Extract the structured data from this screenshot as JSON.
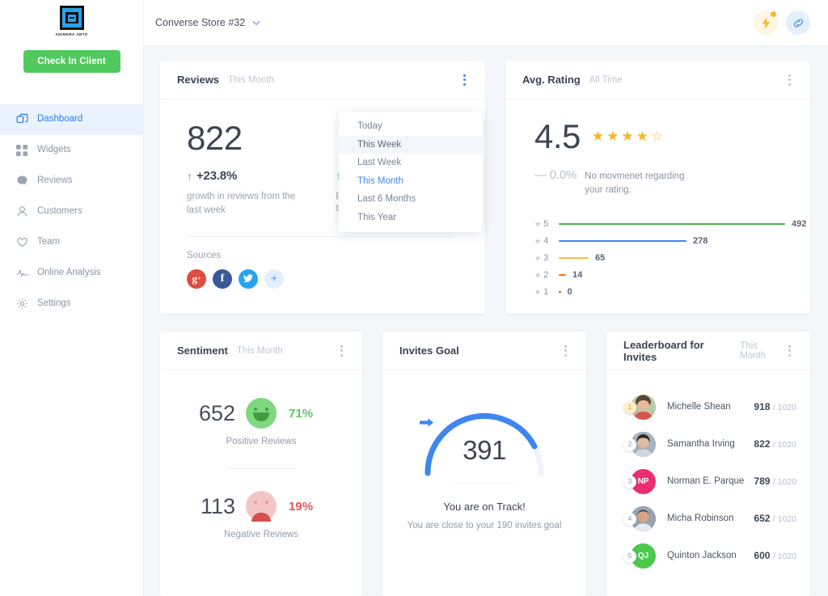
{
  "brand": {
    "name": "ADINKRA ARTS",
    "logo_icon": "adinkra-square-logo"
  },
  "sidebar": {
    "cta_label": "Check In Client",
    "items": [
      {
        "label": "Dashboard",
        "icon": "layers-icon",
        "active": true
      },
      {
        "label": "Widgets",
        "icon": "grid-icon",
        "active": false
      },
      {
        "label": "Reviews",
        "icon": "speech-bubble-icon",
        "active": false
      },
      {
        "label": "Customers",
        "icon": "user-icon",
        "active": false
      },
      {
        "label": "Team",
        "icon": "heart-icon",
        "active": false
      },
      {
        "label": "Online Analysis",
        "icon": "pulse-icon",
        "active": false
      },
      {
        "label": "Settings",
        "icon": "gear-icon",
        "active": false
      }
    ]
  },
  "topbar": {
    "store_name": "Converse Store #32",
    "chevron_icon": "chevron-down-icon",
    "actions": [
      {
        "icon": "lightning-bolt-icon",
        "has_badge": true
      },
      {
        "icon": "link-chain-icon",
        "has_badge": false
      }
    ]
  },
  "reviews_card": {
    "title": "Reviews",
    "period": "This Month",
    "count": "822",
    "delta": "+23.8%",
    "delta_icon": "arrow-up-icon",
    "delta_desc": "growth in reviews from the last week",
    "sources_label": "Sources",
    "sources": [
      {
        "name": "google-plus",
        "glyph": "g+",
        "color": "#dc4e41"
      },
      {
        "name": "facebook",
        "glyph": "f",
        "color": "#3b5998"
      },
      {
        "name": "twitter",
        "glyph": "ᴠ",
        "color": "#2aa3ef"
      },
      {
        "name": "add-source",
        "glyph": "+",
        "color": "#e6f0fd"
      }
    ],
    "dropdown": {
      "items": [
        {
          "label": "Today",
          "state": "normal"
        },
        {
          "label": "This Week",
          "state": "hover"
        },
        {
          "label": "Last Week",
          "state": "normal"
        },
        {
          "label": "This Month",
          "state": "selected"
        },
        {
          "label": "Last 6 Months",
          "state": "normal"
        },
        {
          "label": "This Year",
          "state": "normal"
        }
      ]
    }
  },
  "rating_card": {
    "title": "Avg. Rating",
    "period": "All Time",
    "score": "4.5",
    "stars_filled": 4,
    "stars_half": 1,
    "movement": "0.0%",
    "movement_icon": "dash-icon",
    "movement_desc": "No movmenet regarding your rating.",
    "breakdown": [
      {
        "stars": "5",
        "value": "492",
        "color": "#4caf50",
        "pct": 100
      },
      {
        "stars": "4",
        "value": "278",
        "color": "#4285f4",
        "pct": 56.5
      },
      {
        "stars": "3",
        "value": "65",
        "color": "#fbbc3d",
        "pct": 13.2
      },
      {
        "stars": "2",
        "value": "14",
        "color": "#f4761f",
        "pct": 2.8
      },
      {
        "stars": "1",
        "value": "0",
        "color": "#e53935",
        "pct": 0
      }
    ]
  },
  "sentiment_card": {
    "title": "Sentiment",
    "period": "This Month",
    "positive": {
      "count": "652",
      "pct": "71%",
      "caption": "Positive Reviews",
      "icon": "happy-face-icon"
    },
    "negative": {
      "count": "113",
      "pct": "19%",
      "caption": "Negative Reviews",
      "icon": "sad-face-icon"
    }
  },
  "invites_card": {
    "title": "Invites Goal",
    "value": "391",
    "gauge_pct": 85,
    "plane_icon": "paper-plane-icon",
    "status": "You are on Track!",
    "sub": "You are close to your 190 invites goal"
  },
  "leaderboard_card": {
    "title": "Leaderboard for Invites",
    "period": "This Month",
    "total": "/ 1020",
    "rows": [
      {
        "rank": "1",
        "name": "Michelle Shean",
        "score": "918",
        "total": "/ 1020",
        "avatar_type": "photo",
        "initials": "",
        "color": "#c8a487",
        "gold": true
      },
      {
        "rank": "2",
        "name": "Samantha Irving",
        "score": "822",
        "total": "/ 1020",
        "avatar_type": "photo",
        "initials": "",
        "color": "#9aa7b4",
        "gold": false
      },
      {
        "rank": "3",
        "name": "Norman E. Parque",
        "score": "789",
        "total": "/ 1020",
        "avatar_type": "initials",
        "initials": "NP",
        "color": "#ec2d72",
        "gold": false
      },
      {
        "rank": "4",
        "name": "Micha Robinson",
        "score": "652",
        "total": "/ 1020",
        "avatar_type": "photo",
        "initials": "",
        "color": "#8d9aa8",
        "gold": false
      },
      {
        "rank": "5",
        "name": "Quinton Jackson",
        "score": "600",
        "total": "/ 1020",
        "avatar_type": "initials",
        "initials": "QJ",
        "color": "#4cc94c",
        "gold": false
      }
    ]
  }
}
